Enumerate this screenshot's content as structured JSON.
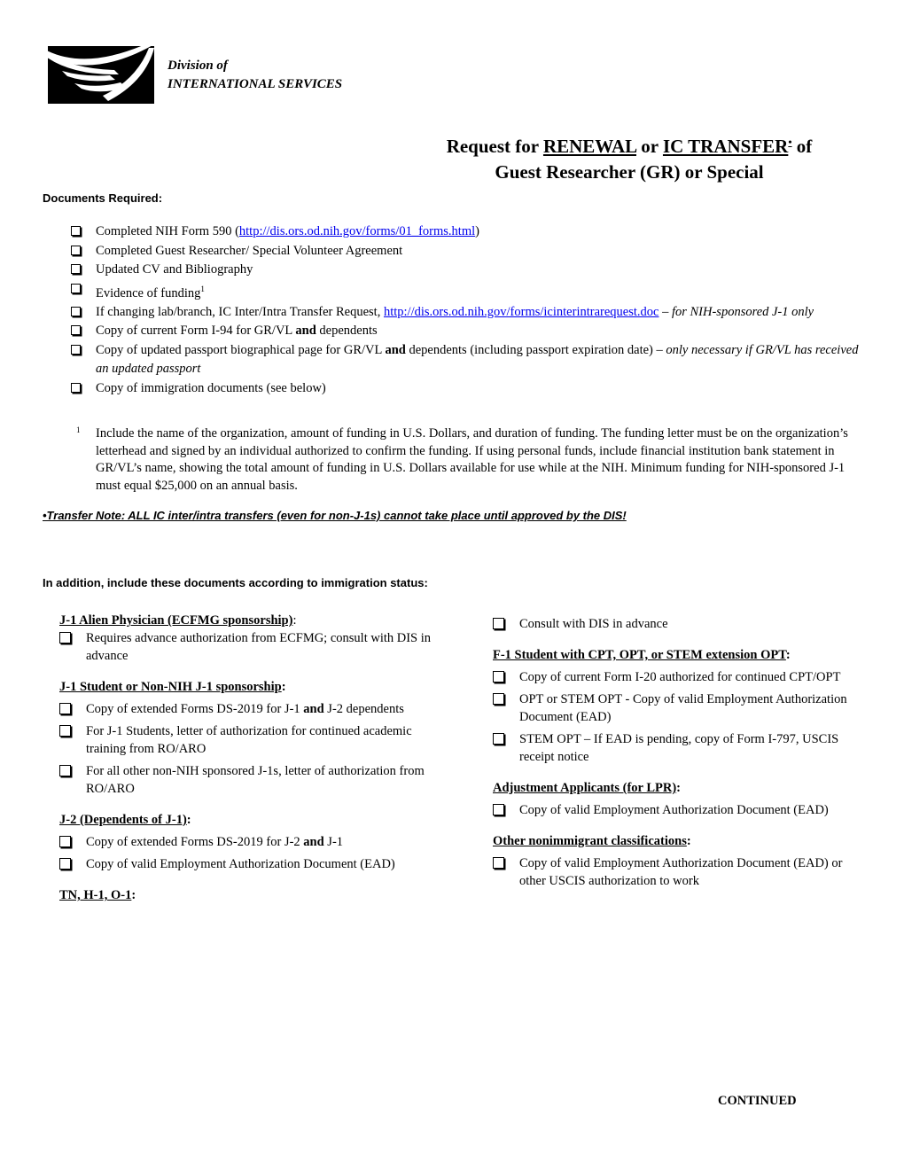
{
  "header": {
    "logo_icon": "dis-logo-icon",
    "org_line1": "Division of",
    "org_line2": "INTERNATIONAL SERVICES"
  },
  "title": {
    "part1": "Request for ",
    "renewal": "RENEWAL",
    "or": " or ",
    "ic_transfer": "IC TRANSFER",
    "bullet_mark": "•",
    "part2": " of",
    "line2": "Guest Researcher (GR) or Special"
  },
  "documents_required": {
    "heading": "Documents Required:",
    "items": [
      {
        "text": "Completed NIH Form 590 (",
        "link": "http://dis.ors.od.nih.gov/forms/01_forms.html",
        "after": ")"
      },
      {
        "text": "Completed Guest Researcher/ Special Volunteer Agreement"
      },
      {
        "text": "Updated CV and Bibliography"
      },
      {
        "text": "Evidence of funding",
        "footnote_ref": "1"
      },
      {
        "text": "If changing lab/branch, IC Inter/Intra Transfer Request, ",
        "link": "http://dis.ors.od.nih.gov/forms/icinterintrarequest.doc",
        "dash": " – ",
        "italic": "for NIH-sponsored J-1 only"
      },
      {
        "pre": "Copy of current Form I-94 for GR/VL ",
        "bold": "and",
        "post": " dependents"
      },
      {
        "pre": "Copy of updated passport biographical page for GR/VL ",
        "bold": "and",
        "post": " dependents (including passport expiration date) – ",
        "italic": "only necessary if GR/VL has received an updated passport"
      },
      {
        "text": "Copy of immigration documents (see below)"
      }
    ]
  },
  "footnote": {
    "mark": "1",
    "text": "Include the name of the organization, amount of funding in U.S. Dollars, and duration of funding.  The funding letter must be on the organization’s letterhead and signed by an individual authorized to confirm the funding.  If using personal funds, include financial institution bank statement in GR/VL’s name, showing the total amount of funding in U.S. Dollars available for use while at the NIH.  Minimum funding for NIH-sponsored J-1 must equal $25,000 on an annual basis."
  },
  "transfer_note": "•Transfer Note:   ALL IC inter/intra transfers (even for non-J-1s) cannot take place until approved by the DIS!",
  "in_addition_heading": "In addition, include these documents according to immigration status:",
  "left_column": [
    {
      "heading": "J-1 Alien Physician (ECFMG sponsorship)",
      "items": [
        {
          "text": "Requires advance authorization from ECFMG; consult with DIS in advance"
        }
      ]
    },
    {
      "heading": "J-1 Student or Non-NIH J-1 sponsorship",
      "items": [
        {
          "pre": "Copy of  extended Forms DS-2019 for J-1 ",
          "bold": "and",
          "post": " J-2 dependents"
        },
        {
          "text": "For J-1 Students, letter of authorization for continued academic training from RO/ARO"
        },
        {
          "text": "For all other non-NIH sponsored J-1s, letter of authorization from RO/ARO"
        }
      ]
    },
    {
      "heading": "J-2 (Dependents of J-1)",
      "items": [
        {
          "pre": "Copy of extended Forms DS-2019 for J-2 ",
          "bold": "and",
          "post": " J-1"
        },
        {
          "text": "Copy of valid Employment Authorization Document (EAD)"
        }
      ]
    },
    {
      "heading": "TN, H-1, O-1",
      "items": []
    }
  ],
  "right_column": [
    {
      "heading": "",
      "items": [
        {
          "text": "Consult with DIS in advance"
        }
      ]
    },
    {
      "heading": "F-1 Student with CPT, OPT, or STEM extension OPT",
      "items": [
        {
          "text": "Copy of current Form I-20 authorized for continued CPT/OPT"
        },
        {
          "text": "OPT or STEM OPT - Copy of valid Employment Authorization Document (EAD)"
        },
        {
          "text": "STEM OPT – If EAD is pending, copy of Form I-797, USCIS receipt notice"
        }
      ]
    },
    {
      "heading": "Adjustment Applicants (for LPR)",
      "items": [
        {
          "text": "Copy of valid Employment Authorization Document (EAD)"
        }
      ]
    },
    {
      "heading": "Other nonimmigrant classifications",
      "items": [
        {
          "text": "Copy of valid Employment Authorization Document (EAD) or other USCIS authorization to work"
        }
      ]
    }
  ],
  "colon": ":",
  "footer": {
    "continued": "CONTINUED"
  },
  "colors": {
    "link": "#0000ee",
    "text": "#000000"
  }
}
